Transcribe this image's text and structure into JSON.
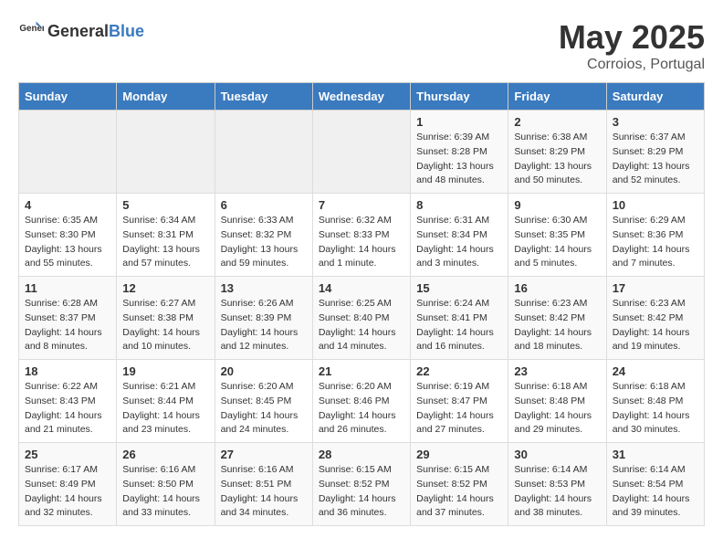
{
  "header": {
    "logo_general": "General",
    "logo_blue": "Blue",
    "month": "May 2025",
    "location": "Corroios, Portugal"
  },
  "days_of_week": [
    "Sunday",
    "Monday",
    "Tuesday",
    "Wednesday",
    "Thursday",
    "Friday",
    "Saturday"
  ],
  "weeks": [
    [
      {
        "day": "",
        "info": ""
      },
      {
        "day": "",
        "info": ""
      },
      {
        "day": "",
        "info": ""
      },
      {
        "day": "",
        "info": ""
      },
      {
        "day": "1",
        "info": "Sunrise: 6:39 AM\nSunset: 8:28 PM\nDaylight: 13 hours\nand 48 minutes."
      },
      {
        "day": "2",
        "info": "Sunrise: 6:38 AM\nSunset: 8:29 PM\nDaylight: 13 hours\nand 50 minutes."
      },
      {
        "day": "3",
        "info": "Sunrise: 6:37 AM\nSunset: 8:29 PM\nDaylight: 13 hours\nand 52 minutes."
      }
    ],
    [
      {
        "day": "4",
        "info": "Sunrise: 6:35 AM\nSunset: 8:30 PM\nDaylight: 13 hours\nand 55 minutes."
      },
      {
        "day": "5",
        "info": "Sunrise: 6:34 AM\nSunset: 8:31 PM\nDaylight: 13 hours\nand 57 minutes."
      },
      {
        "day": "6",
        "info": "Sunrise: 6:33 AM\nSunset: 8:32 PM\nDaylight: 13 hours\nand 59 minutes."
      },
      {
        "day": "7",
        "info": "Sunrise: 6:32 AM\nSunset: 8:33 PM\nDaylight: 14 hours\nand 1 minute."
      },
      {
        "day": "8",
        "info": "Sunrise: 6:31 AM\nSunset: 8:34 PM\nDaylight: 14 hours\nand 3 minutes."
      },
      {
        "day": "9",
        "info": "Sunrise: 6:30 AM\nSunset: 8:35 PM\nDaylight: 14 hours\nand 5 minutes."
      },
      {
        "day": "10",
        "info": "Sunrise: 6:29 AM\nSunset: 8:36 PM\nDaylight: 14 hours\nand 7 minutes."
      }
    ],
    [
      {
        "day": "11",
        "info": "Sunrise: 6:28 AM\nSunset: 8:37 PM\nDaylight: 14 hours\nand 8 minutes."
      },
      {
        "day": "12",
        "info": "Sunrise: 6:27 AM\nSunset: 8:38 PM\nDaylight: 14 hours\nand 10 minutes."
      },
      {
        "day": "13",
        "info": "Sunrise: 6:26 AM\nSunset: 8:39 PM\nDaylight: 14 hours\nand 12 minutes."
      },
      {
        "day": "14",
        "info": "Sunrise: 6:25 AM\nSunset: 8:40 PM\nDaylight: 14 hours\nand 14 minutes."
      },
      {
        "day": "15",
        "info": "Sunrise: 6:24 AM\nSunset: 8:41 PM\nDaylight: 14 hours\nand 16 minutes."
      },
      {
        "day": "16",
        "info": "Sunrise: 6:23 AM\nSunset: 8:42 PM\nDaylight: 14 hours\nand 18 minutes."
      },
      {
        "day": "17",
        "info": "Sunrise: 6:23 AM\nSunset: 8:42 PM\nDaylight: 14 hours\nand 19 minutes."
      }
    ],
    [
      {
        "day": "18",
        "info": "Sunrise: 6:22 AM\nSunset: 8:43 PM\nDaylight: 14 hours\nand 21 minutes."
      },
      {
        "day": "19",
        "info": "Sunrise: 6:21 AM\nSunset: 8:44 PM\nDaylight: 14 hours\nand 23 minutes."
      },
      {
        "day": "20",
        "info": "Sunrise: 6:20 AM\nSunset: 8:45 PM\nDaylight: 14 hours\nand 24 minutes."
      },
      {
        "day": "21",
        "info": "Sunrise: 6:20 AM\nSunset: 8:46 PM\nDaylight: 14 hours\nand 26 minutes."
      },
      {
        "day": "22",
        "info": "Sunrise: 6:19 AM\nSunset: 8:47 PM\nDaylight: 14 hours\nand 27 minutes."
      },
      {
        "day": "23",
        "info": "Sunrise: 6:18 AM\nSunset: 8:48 PM\nDaylight: 14 hours\nand 29 minutes."
      },
      {
        "day": "24",
        "info": "Sunrise: 6:18 AM\nSunset: 8:48 PM\nDaylight: 14 hours\nand 30 minutes."
      }
    ],
    [
      {
        "day": "25",
        "info": "Sunrise: 6:17 AM\nSunset: 8:49 PM\nDaylight: 14 hours\nand 32 minutes."
      },
      {
        "day": "26",
        "info": "Sunrise: 6:16 AM\nSunset: 8:50 PM\nDaylight: 14 hours\nand 33 minutes."
      },
      {
        "day": "27",
        "info": "Sunrise: 6:16 AM\nSunset: 8:51 PM\nDaylight: 14 hours\nand 34 minutes."
      },
      {
        "day": "28",
        "info": "Sunrise: 6:15 AM\nSunset: 8:52 PM\nDaylight: 14 hours\nand 36 minutes."
      },
      {
        "day": "29",
        "info": "Sunrise: 6:15 AM\nSunset: 8:52 PM\nDaylight: 14 hours\nand 37 minutes."
      },
      {
        "day": "30",
        "info": "Sunrise: 6:14 AM\nSunset: 8:53 PM\nDaylight: 14 hours\nand 38 minutes."
      },
      {
        "day": "31",
        "info": "Sunrise: 6:14 AM\nSunset: 8:54 PM\nDaylight: 14 hours\nand 39 minutes."
      }
    ]
  ]
}
